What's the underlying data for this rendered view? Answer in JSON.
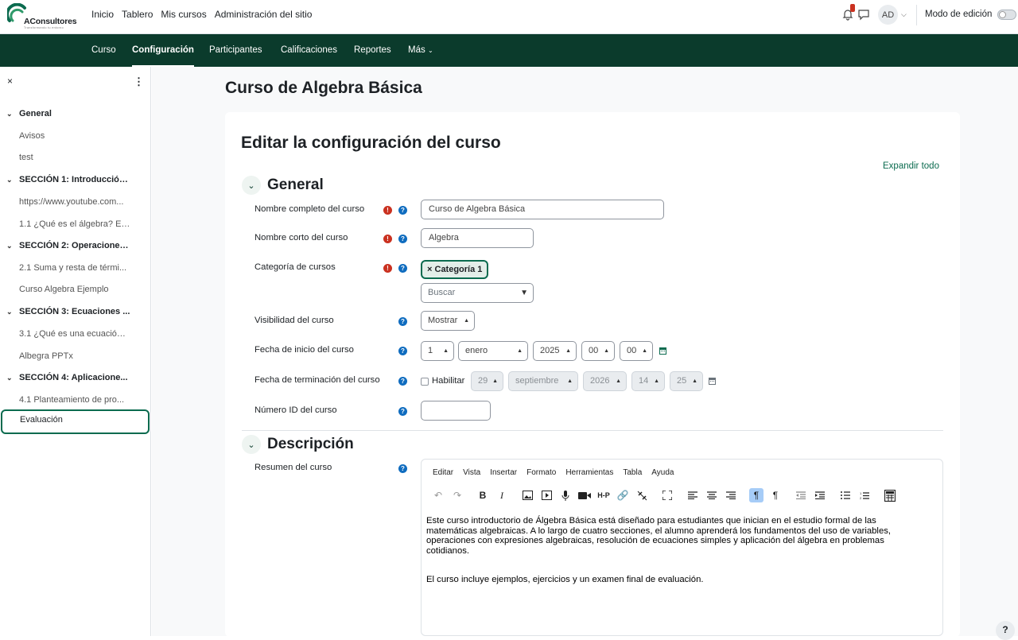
{
  "brand": {
    "name": "AConsultores",
    "tagline": "Transformando tu entorno"
  },
  "topnav": {
    "items": [
      "Inicio",
      "Tablero",
      "Mis cursos",
      "Administración del sitio"
    ]
  },
  "user": {
    "initials": "AD",
    "notification_count": "1",
    "edit_mode_label": "Modo de edición",
    "edit_mode_on": false
  },
  "course_nav": {
    "items": [
      "Curso",
      "Configuración",
      "Participantes",
      "Calificaciones",
      "Reportes",
      "Más"
    ],
    "active": "Configuración"
  },
  "drawer": {
    "close_label": "×",
    "items": [
      {
        "label": "General",
        "type": "section"
      },
      {
        "label": "Avisos",
        "type": "item"
      },
      {
        "label": "test",
        "type": "item"
      },
      {
        "label": "SECCIÓN 1: Introducción...",
        "type": "section"
      },
      {
        "label": "https://www.youtube.com...",
        "type": "item"
      },
      {
        "label": "1.1 ¿Qué es el álgebra? El á...",
        "type": "item"
      },
      {
        "label": "SECCIÓN 2: Operaciones...",
        "type": "section"
      },
      {
        "label": "2.1 Suma y resta de térmi...",
        "type": "item"
      },
      {
        "label": "Curso Algebra Ejemplo",
        "type": "item"
      },
      {
        "label": "SECCIÓN 3: Ecuaciones ...",
        "type": "section"
      },
      {
        "label": "3.1 ¿Qué es una ecuación?...",
        "type": "item"
      },
      {
        "label": "Albegra PPTx",
        "type": "item"
      },
      {
        "label": "SECCIÓN 4: Aplicacione...",
        "type": "section"
      },
      {
        "label": "4.1 Planteamiento de pro...",
        "type": "item"
      },
      {
        "label": "Evaluación",
        "type": "item",
        "selected": true
      }
    ]
  },
  "page": {
    "course_title": "Curso de Algebra Básica",
    "form_title": "Editar la configuración del curso",
    "expand_all": "Expandir todo"
  },
  "general": {
    "heading": "General",
    "fullname": {
      "label": "Nombre completo del curso",
      "value": "Curso de Algebra Básica"
    },
    "shortname": {
      "label": "Nombre corto del curso",
      "value": "Algebra"
    },
    "category": {
      "label": "Categoría de cursos",
      "chip": "Categoría 1",
      "search_placeholder": "Buscar"
    },
    "visibility": {
      "label": "Visibilidad del curso",
      "value": "Mostrar"
    },
    "startdate": {
      "label": "Fecha de inicio del curso",
      "day": "1",
      "month": "enero",
      "year": "2025",
      "hour": "00",
      "minute": "00"
    },
    "enddate": {
      "label": "Fecha de terminación del curso",
      "enable_label": "Habilitar",
      "enabled": false,
      "day": "29",
      "month": "septiembre",
      "year": "2026",
      "hour": "14",
      "minute": "25"
    },
    "idnumber": {
      "label": "Número ID del curso",
      "value": ""
    }
  },
  "description": {
    "heading": "Descripción",
    "summary_label": "Resumen del curso",
    "menu": [
      "Editar",
      "Vista",
      "Insertar",
      "Formato",
      "Herramientas",
      "Tabla",
      "Ayuda"
    ],
    "paragraphs": [
      "Este curso introductorio de Álgebra Básica está diseñado para estudiantes que inician en el estudio formal de las matemáticas algebraicas. A lo largo de cuatro secciones, el alumno aprenderá los fundamentos del uso de variables, operaciones con expresiones algebraicas, resolución de ecuaciones simples y aplicación del álgebra en problemas cotidianos.",
      "El curso incluye ejemplos, ejercicios y un examen final de evaluación."
    ]
  },
  "footer": {
    "help_label": "?"
  },
  "colors": {
    "nav_bg": "#0b3b2c",
    "accent": "#0b6b4f",
    "required": "#ca3120",
    "help": "#0f6cbf"
  }
}
